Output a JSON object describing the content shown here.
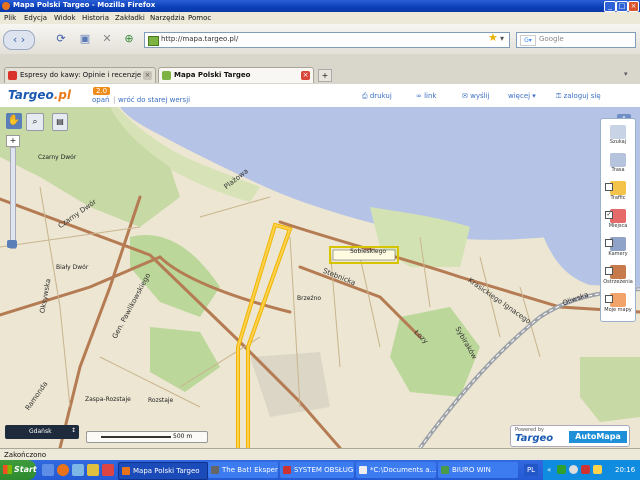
{
  "window": {
    "title": "Mapa Polski Targeo - Mozilla Firefox"
  },
  "menu": [
    "Plik",
    "Edycja",
    "Widok",
    "Historia",
    "Zakładki",
    "Narzędzia",
    "Pomoc"
  ],
  "nav": {
    "url": "http://mapa.targeo.pl/",
    "search_placeholder": "Google"
  },
  "tabs": [
    {
      "label": "Espresy do kawy: Opinie i recenzje"
    },
    {
      "label": "Mapa Polski Targeo"
    }
  ],
  "page": {
    "logo": "Targeo",
    "logo_suffix": ".pl",
    "version": "2.0",
    "links_left": [
      "opań",
      "wróć do starej wersji"
    ],
    "top_links": [
      "drukuj",
      "link",
      "wyślij",
      "więcej",
      "zaloguj się"
    ]
  },
  "map": {
    "street_labels": [
      "Plażowa",
      "Czarny Dwór",
      "Oksywska",
      "Gen. Pawlikowskiego",
      "Ramonda",
      "Stebnicka",
      "Łozy",
      "Sybiraków",
      "Krasickiego Ignacego",
      "Oliwska"
    ],
    "place_labels": [
      "Czarny Dwór",
      "Biały Dwór",
      "Brzeźno",
      "Zaspa-Rozstaje",
      "Rozstaje",
      "Sobieskiego"
    ],
    "scale_label": "500 m",
    "zoom_dropdown": "Gdańsk",
    "powered_by": "Powered by",
    "brand_targeo": "Targeo",
    "brand_automapa": "AutoMapa",
    "collapse_label": "«"
  },
  "right_panel": [
    {
      "label": "Szukaj",
      "checked": false
    },
    {
      "label": "Trasa",
      "checked": false
    },
    {
      "label": "Traffic",
      "checked": false
    },
    {
      "label": "Miejsca",
      "checked": true
    },
    {
      "label": "Kamery",
      "checked": false
    },
    {
      "label": "Ostrzeżenia",
      "checked": false
    },
    {
      "label": "Moje mapy",
      "checked": false
    }
  ],
  "status": {
    "text": "Zakończono"
  },
  "taskbar": {
    "start": "Start",
    "tasks": [
      {
        "label": "Mapa Polski Targeo"
      },
      {
        "label": "The Bat! Ekspert"
      },
      {
        "label": "SYSTEM OBSŁUGI"
      },
      {
        "label": "*C:\\Documents a..."
      },
      {
        "label": "BIURO WIN"
      }
    ],
    "clock": "20:16",
    "lang": "PL"
  }
}
